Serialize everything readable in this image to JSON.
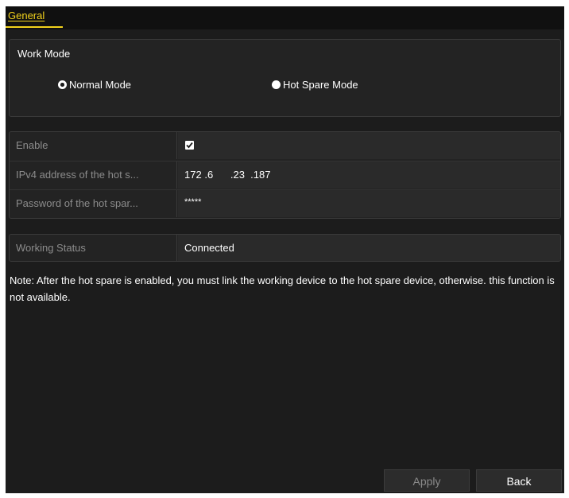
{
  "tabs": [
    {
      "label": "General",
      "active": true
    }
  ],
  "work_mode": {
    "title": "Work Mode",
    "options": [
      {
        "label": "Normal Mode",
        "selected": true
      },
      {
        "label": "Hot Spare Mode",
        "selected": false
      }
    ]
  },
  "settings": {
    "rows": [
      {
        "label": "Enable",
        "checked": true
      },
      {
        "label": "IPv4 address of the hot s...",
        "ip": [
          "172",
          "6",
          "23",
          "187"
        ]
      },
      {
        "label": "Password of the hot spar...",
        "value": "*****"
      }
    ]
  },
  "status": {
    "label": "Working Status",
    "value": "Connected"
  },
  "note": "Note: After the hot spare is enabled, you must link the working device to the hot spare device, otherwise. this function is not available.",
  "buttons": {
    "apply": "Apply",
    "back": "Back"
  },
  "colors": {
    "accent": "#f2d21c",
    "background": "#1c1c1c",
    "label_text": "#8c8c8c"
  }
}
